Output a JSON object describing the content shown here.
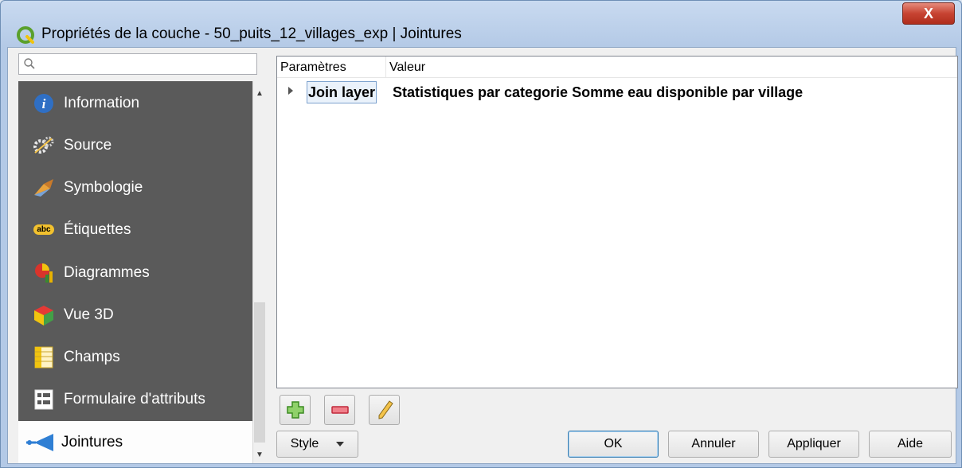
{
  "window": {
    "title": "Propriétés de la couche - 50_puits_12_villages_exp | Jointures",
    "close_label": "X"
  },
  "search": {
    "placeholder": ""
  },
  "sidebar": {
    "items": [
      {
        "label": "Information",
        "icon": "info-icon"
      },
      {
        "label": "Source",
        "icon": "source-icon"
      },
      {
        "label": "Symbologie",
        "icon": "symbology-icon"
      },
      {
        "label": "Étiquettes",
        "icon": "labels-icon",
        "icon_text": "abc"
      },
      {
        "label": "Diagrammes",
        "icon": "diagrams-icon"
      },
      {
        "label": "Vue 3D",
        "icon": "3d-view-icon"
      },
      {
        "label": "Champs",
        "icon": "fields-icon"
      },
      {
        "label": "Formulaire d'attributs",
        "icon": "attribute-form-icon"
      },
      {
        "label": "Jointures",
        "icon": "joins-icon",
        "selected": true
      }
    ]
  },
  "tree": {
    "headers": [
      "Paramètres",
      "Valeur"
    ],
    "row": {
      "param": "Join layer",
      "value": "Statistiques par categorie Somme eau disponible par village"
    }
  },
  "buttons": {
    "style": "Style",
    "ok": "OK",
    "cancel": "Annuler",
    "apply": "Appliquer",
    "help": "Aide"
  },
  "colors": {
    "sidebar_bg": "#5a5a5a",
    "selected_bg": "#fdfdfd",
    "close_red": "#c74332",
    "qgis_green": "#5aa02c"
  }
}
